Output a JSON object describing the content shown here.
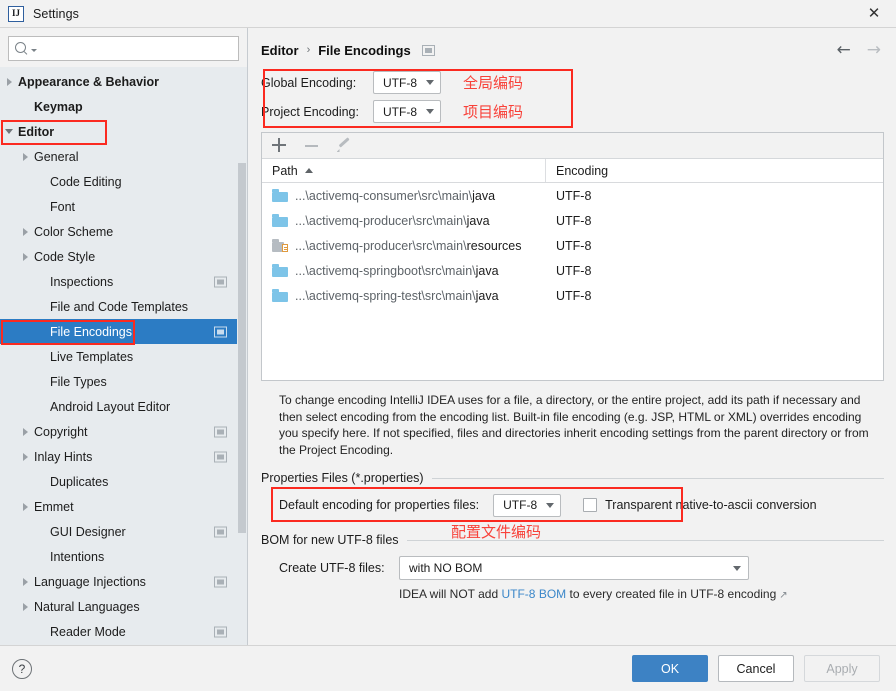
{
  "window": {
    "title": "Settings",
    "logo_text": "IJ",
    "close_icon": "close-icon"
  },
  "sidebar": {
    "search": {
      "placeholder": "",
      "value": "",
      "icon": "search-icon"
    },
    "items": [
      {
        "label": "Appearance & Behavior",
        "twisty": "right",
        "bold": true,
        "indent": 0,
        "badge": false,
        "selected": false
      },
      {
        "label": "Keymap",
        "twisty": "none",
        "bold": true,
        "indent": 1,
        "badge": false,
        "selected": false
      },
      {
        "label": "Editor",
        "twisty": "down",
        "bold": true,
        "indent": 0,
        "badge": false,
        "selected": false
      },
      {
        "label": "General",
        "twisty": "right",
        "bold": false,
        "indent": 1,
        "badge": false,
        "selected": false
      },
      {
        "label": "Code Editing",
        "twisty": "none",
        "bold": false,
        "indent": 2,
        "badge": false,
        "selected": false
      },
      {
        "label": "Font",
        "twisty": "none",
        "bold": false,
        "indent": 2,
        "badge": false,
        "selected": false
      },
      {
        "label": "Color Scheme",
        "twisty": "right",
        "bold": false,
        "indent": 1,
        "badge": false,
        "selected": false
      },
      {
        "label": "Code Style",
        "twisty": "right",
        "bold": false,
        "indent": 1,
        "badge": false,
        "selected": false
      },
      {
        "label": "Inspections",
        "twisty": "none",
        "bold": false,
        "indent": 2,
        "badge": true,
        "selected": false
      },
      {
        "label": "File and Code Templates",
        "twisty": "none",
        "bold": false,
        "indent": 2,
        "badge": false,
        "selected": false
      },
      {
        "label": "File Encodings",
        "twisty": "none",
        "bold": false,
        "indent": 2,
        "badge": true,
        "selected": true
      },
      {
        "label": "Live Templates",
        "twisty": "none",
        "bold": false,
        "indent": 2,
        "badge": false,
        "selected": false
      },
      {
        "label": "File Types",
        "twisty": "none",
        "bold": false,
        "indent": 2,
        "badge": false,
        "selected": false
      },
      {
        "label": "Android Layout Editor",
        "twisty": "none",
        "bold": false,
        "indent": 2,
        "badge": false,
        "selected": false
      },
      {
        "label": "Copyright",
        "twisty": "right",
        "bold": false,
        "indent": 1,
        "badge": true,
        "selected": false
      },
      {
        "label": "Inlay Hints",
        "twisty": "right",
        "bold": false,
        "indent": 1,
        "badge": true,
        "selected": false
      },
      {
        "label": "Duplicates",
        "twisty": "none",
        "bold": false,
        "indent": 2,
        "badge": false,
        "selected": false
      },
      {
        "label": "Emmet",
        "twisty": "right",
        "bold": false,
        "indent": 1,
        "badge": false,
        "selected": false
      },
      {
        "label": "GUI Designer",
        "twisty": "none",
        "bold": false,
        "indent": 2,
        "badge": true,
        "selected": false
      },
      {
        "label": "Intentions",
        "twisty": "none",
        "bold": false,
        "indent": 2,
        "badge": false,
        "selected": false
      },
      {
        "label": "Language Injections",
        "twisty": "right",
        "bold": false,
        "indent": 1,
        "badge": true,
        "selected": false
      },
      {
        "label": "Natural Languages",
        "twisty": "right",
        "bold": false,
        "indent": 1,
        "badge": false,
        "selected": false
      },
      {
        "label": "Reader Mode",
        "twisty": "none",
        "bold": false,
        "indent": 2,
        "badge": true,
        "selected": false
      }
    ]
  },
  "breadcrumb": {
    "parent": "Editor",
    "separator": "›",
    "current": "File Encodings",
    "project_icon": "project-scope-icon",
    "back_icon": "←",
    "forward_icon": "→"
  },
  "encoding": {
    "global_label": "Global Encoding:",
    "global_value": "UTF-8",
    "project_label": "Project Encoding:",
    "project_value": "UTF-8",
    "annotation_global": "全局编码",
    "annotation_project": "项目编码"
  },
  "table": {
    "toolbar": {
      "add": "add-row-icon",
      "remove": "remove-row-icon",
      "edit": "edit-row-icon"
    },
    "columns": [
      "Path",
      "Encoding"
    ],
    "sort_column": "Path",
    "sort_direction": "asc",
    "rows": [
      {
        "path": "...\\activemq-consumer\\src\\main\\",
        "leaf": "java",
        "encoding": "UTF-8",
        "icon": "folder-icon"
      },
      {
        "path": "...\\activemq-producer\\src\\main\\",
        "leaf": "java",
        "encoding": "UTF-8",
        "icon": "folder-icon"
      },
      {
        "path": "...\\activemq-producer\\src\\main\\",
        "leaf": "resources",
        "encoding": "UTF-8",
        "icon": "resources-folder-icon"
      },
      {
        "path": "...\\activemq-springboot\\src\\main\\",
        "leaf": "java",
        "encoding": "UTF-8",
        "icon": "folder-icon"
      },
      {
        "path": "...\\activemq-spring-test\\src\\main\\",
        "leaf": "java",
        "encoding": "UTF-8",
        "icon": "folder-icon"
      }
    ]
  },
  "description": "To change encoding IntelliJ IDEA uses for a file, a directory, or the entire project, add its path if necessary and then select encoding from the encoding list. Built-in file encoding (e.g. JSP, HTML or XML) overrides encoding you specify here. If not specified, files and directories inherit encoding settings from the parent directory or from the Project Encoding.",
  "properties_section": {
    "title": "Properties Files (*.properties)",
    "default_encoding_label": "Default encoding for properties files:",
    "default_encoding_value": "UTF-8",
    "transparent_label": "Transparent native-to-ascii conversion",
    "transparent_checked": false,
    "annotation": "配置文件编码"
  },
  "bom_section": {
    "title": "BOM for new UTF-8 files",
    "create_label": "Create UTF-8 files:",
    "create_value": "with NO BOM",
    "note_prefix": "IDEA will NOT add ",
    "note_link": "UTF-8 BOM",
    "note_suffix": " to every created file in UTF-8 encoding",
    "external_icon": "↗"
  },
  "footer": {
    "help_label": "?",
    "ok": "OK",
    "cancel": "Cancel",
    "apply": "Apply"
  },
  "colors": {
    "selection_blue": "#2c7cc4",
    "primary_button": "#3d82c4",
    "annotation_red": "#fb2a20",
    "link_blue": "#3b87c9",
    "sidebar_bg": "#e7ebee",
    "panel_bg": "#f2f2f2"
  }
}
